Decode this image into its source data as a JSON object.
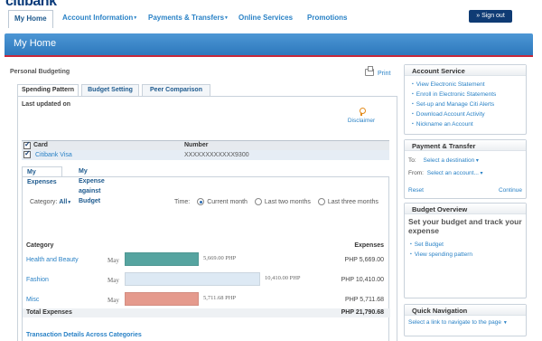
{
  "brand": {
    "logo_text": "citibank"
  },
  "nav": {
    "tabs": [
      {
        "label": "My Home",
        "has_menu": false
      },
      {
        "label": "Account Information",
        "has_menu": true
      },
      {
        "label": "Payments & Transfers",
        "has_menu": true
      },
      {
        "label": "Online Services",
        "has_menu": false
      },
      {
        "label": "Promotions",
        "has_menu": false
      }
    ],
    "signout_label": "Sign out",
    "signout_icon": "double-chevron-right-icon"
  },
  "banner": {
    "title": "My Home"
  },
  "budgeting": {
    "section_title": "Personal Budgeting",
    "print_label": "Print",
    "tabs": [
      "Spending Pattern",
      "Budget Setting",
      "Peer Comparison"
    ],
    "last_updated_label": "Last updated on",
    "disclaimer_label": "Disclaimer",
    "card_table": {
      "headers": {
        "card": "Card",
        "number": "Number"
      },
      "rows": [
        {
          "card": "Citibank Visa",
          "number": "XXXXXXXXXXXX9300"
        }
      ]
    },
    "inner_tabs": [
      "My Expenses",
      "My Expense against Budget"
    ],
    "category_filter": {
      "label": "Category:",
      "value": "All"
    },
    "time_filter": {
      "label": "Time:",
      "options": [
        "Current month",
        "Last two months",
        "Last three months"
      ],
      "selected": 0
    },
    "columns": {
      "category": "Category",
      "expenses": "Expenses"
    },
    "colors": [
      "#56a4a0",
      "#dde9f4",
      "#e59a8d"
    ],
    "total": {
      "label": "Total Expenses",
      "value": "PHP 21,790.68"
    },
    "transactions_link": "Transaction Details Across Categories"
  },
  "expenses": {
    "max": 10410,
    "rows": [
      {
        "name": "Health and Beauty",
        "month": "May",
        "value": 5669,
        "bar_label": "5,669.00 PHP",
        "total": "PHP 5,669.00"
      },
      {
        "name": "Fashion",
        "month": "May",
        "value": 10410,
        "bar_label": "10,410.00 PHP",
        "total": "PHP 10,410.00"
      },
      {
        "name": "Misc",
        "month": "May",
        "value": 5711.68,
        "bar_label": "5,711.68 PHP",
        "total": "PHP 5,711.68"
      }
    ]
  },
  "sidebar": {
    "account_service": {
      "title": "Account Service",
      "links": [
        "View Electronic Statement",
        "Enroll in Electronic Statements",
        "Set-up and Manage Citi Alerts",
        "Download Account Activity",
        "Nickname an Account"
      ]
    },
    "payment_transfer": {
      "title": "Payment & Transfer",
      "to_label": "To:",
      "to_value": "Select a destination",
      "from_label": "From:",
      "from_value": "Select an account...",
      "reset_label": "Reset",
      "continue_label": "Continue"
    },
    "budget_overview": {
      "title": "Budget Overview",
      "headline": "Set your budget and track your expense",
      "links": [
        "Set Budget",
        "View spending pattern"
      ]
    },
    "quick_navigation": {
      "title": "Quick Navigation",
      "link": "Select a link to navigate to the page"
    }
  }
}
